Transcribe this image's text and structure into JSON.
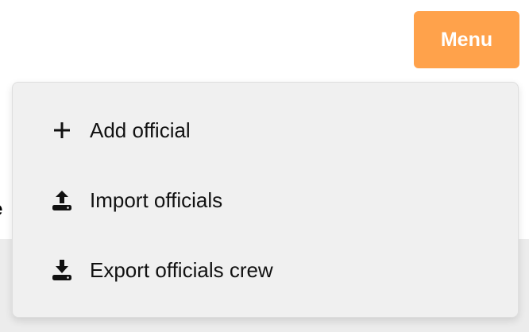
{
  "header": {
    "menu_button_label": "Menu",
    "menu_button_color": "#ffa24b"
  },
  "background": {
    "partial_heading": "e"
  },
  "dropdown": {
    "items": [
      {
        "label": "Add official",
        "icon": "plus-icon"
      },
      {
        "label": "Import officials",
        "icon": "upload-icon"
      },
      {
        "label": "Export officials crew",
        "icon": "download-icon"
      }
    ]
  }
}
